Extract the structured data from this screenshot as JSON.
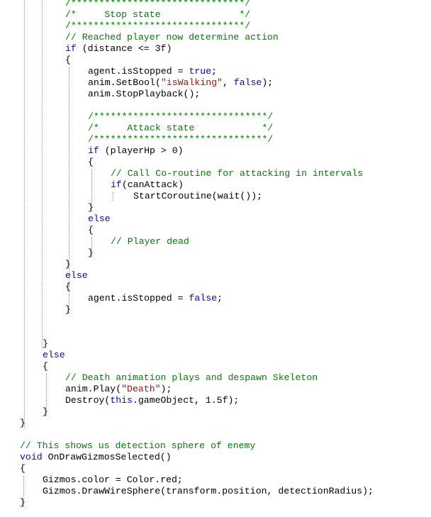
{
  "colors": {
    "background": "#ffffff",
    "code": "#000000",
    "comment": "#008000",
    "keyword": "#0000ff",
    "string": "#a31515",
    "guide": "#9a9a9a"
  },
  "lines": [
    {
      "indent": 2,
      "kind": "comment",
      "text": "/*******************************/"
    },
    {
      "indent": 2,
      "kind": "comment",
      "text": "/*     Stop state              */"
    },
    {
      "indent": 2,
      "kind": "comment",
      "text": "/*******************************/"
    },
    {
      "indent": 2,
      "kind": "comment",
      "text": "// Reached player now determine action"
    },
    {
      "indent": 2,
      "kind": "code",
      "text": "if (distance <= 3f)"
    },
    {
      "indent": 2,
      "kind": "code",
      "text": "{"
    },
    {
      "indent": 3,
      "kind": "code",
      "text": "agent.isStopped = true;"
    },
    {
      "indent": 3,
      "kind": "code",
      "text": "anim.SetBool(\"isWalking\", false);"
    },
    {
      "indent": 3,
      "kind": "code",
      "text": "anim.StopPlayback();"
    },
    {
      "indent": 3,
      "kind": "blank",
      "text": ""
    },
    {
      "indent": 3,
      "kind": "comment",
      "text": "/*******************************/"
    },
    {
      "indent": 3,
      "kind": "comment",
      "text": "/*     Attack state            */"
    },
    {
      "indent": 3,
      "kind": "comment",
      "text": "/*******************************/"
    },
    {
      "indent": 3,
      "kind": "code",
      "text": "if (playerHp > 0)"
    },
    {
      "indent": 3,
      "kind": "code",
      "text": "{"
    },
    {
      "indent": 4,
      "kind": "comment",
      "text": "// Call Co-routine for attacking in intervals"
    },
    {
      "indent": 4,
      "kind": "code",
      "text": "if(canAttack)"
    },
    {
      "indent": 5,
      "kind": "code",
      "text": "StartCoroutine(wait());"
    },
    {
      "indent": 3,
      "kind": "code",
      "text": "}"
    },
    {
      "indent": 3,
      "kind": "code",
      "text": "else"
    },
    {
      "indent": 3,
      "kind": "code",
      "text": "{"
    },
    {
      "indent": 4,
      "kind": "comment",
      "text": "// Player dead"
    },
    {
      "indent": 3,
      "kind": "code",
      "text": "}"
    },
    {
      "indent": 2,
      "kind": "code",
      "text": "}"
    },
    {
      "indent": 2,
      "kind": "code",
      "text": "else"
    },
    {
      "indent": 2,
      "kind": "code",
      "text": "{"
    },
    {
      "indent": 3,
      "kind": "code",
      "text": "agent.isStopped = false;"
    },
    {
      "indent": 2,
      "kind": "code",
      "text": "}"
    },
    {
      "indent": 2,
      "kind": "blank",
      "text": ""
    },
    {
      "indent": 2,
      "kind": "blank",
      "text": ""
    },
    {
      "indent": 1,
      "kind": "code",
      "text": "}"
    },
    {
      "indent": 1,
      "kind": "code",
      "text": "else"
    },
    {
      "indent": 1,
      "kind": "code",
      "text": "{"
    },
    {
      "indent": 2,
      "kind": "comment",
      "text": "// Death animation plays and despawn Skeleton"
    },
    {
      "indent": 2,
      "kind": "code",
      "text": "anim.Play(\"Death\");"
    },
    {
      "indent": 2,
      "kind": "code",
      "text": "Destroy(this.gameObject, 1.5f);"
    },
    {
      "indent": 1,
      "kind": "code",
      "text": "}"
    },
    {
      "indent": 0,
      "kind": "code",
      "text": "}"
    },
    {
      "indent": 0,
      "kind": "blank",
      "text": ""
    },
    {
      "indent": 0,
      "kind": "comment",
      "text": "// This shows us detection sphere of enemy"
    },
    {
      "indent": 0,
      "kind": "code",
      "text": "void OnDrawGizmosSelected()"
    },
    {
      "indent": 0,
      "kind": "code",
      "text": "{"
    },
    {
      "indent": 1,
      "kind": "code",
      "text": "Gizmos.color = Color.red;"
    },
    {
      "indent": 1,
      "kind": "code",
      "text": "Gizmos.DrawWireSphere(transform.position, detectionRadius);"
    },
    {
      "indent": 0,
      "kind": "code",
      "text": "}"
    }
  ]
}
